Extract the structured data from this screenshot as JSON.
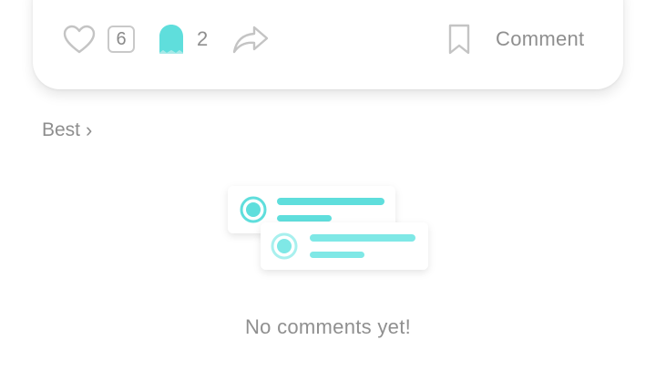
{
  "post_actions": {
    "like_icon": "heart-outline-icon",
    "like_count": "6",
    "ghost_icon": "ghost-icon",
    "ghost_count": "2",
    "share_icon": "share-arrow-icon",
    "bookmark_icon": "bookmark-outline-icon",
    "comment_label": "Comment"
  },
  "comments": {
    "sort_label": "Best",
    "sort_chevron": "›",
    "empty_message": "No comments yet!"
  },
  "colors": {
    "accent": "#5fdedc",
    "accent_dark": "#3fcfcc",
    "text_gray": "#8f8f8f",
    "icon_gray": "#c4c4c4"
  }
}
